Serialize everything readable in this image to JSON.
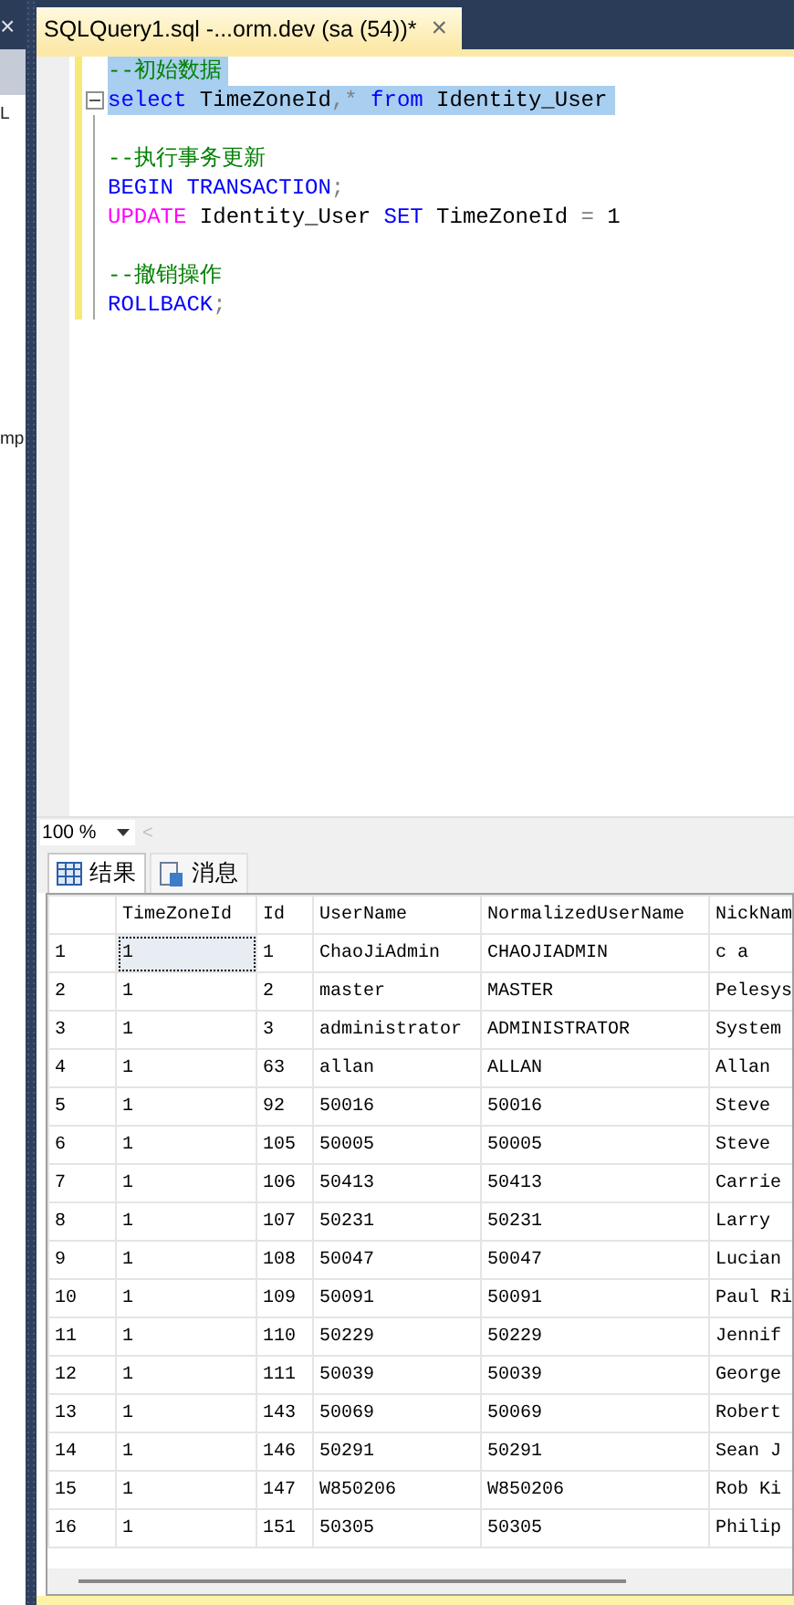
{
  "side_panel": {
    "close": "×",
    "texts": [
      "L",
      "mp"
    ]
  },
  "document_tab": {
    "title": "SQLQuery1.sql -...orm.dev (sa (54))*",
    "close": "×",
    "selected": true
  },
  "editor": {
    "lines": [
      {
        "changed": true,
        "selected": true,
        "segments": [
          {
            "kind": "comment",
            "text": "--初始数据"
          }
        ]
      },
      {
        "changed": true,
        "selected": true,
        "fold": true,
        "segments": [
          {
            "kind": "keyword",
            "text": "select"
          },
          {
            "kind": "plain",
            "text": " TimeZoneId"
          },
          {
            "kind": "punct",
            "text": ",*"
          },
          {
            "kind": "keyword",
            "text": " from"
          },
          {
            "kind": "plain",
            "text": " Identity_User"
          }
        ]
      },
      {
        "changed": true
      },
      {
        "changed": true,
        "selected": false,
        "segments": [
          {
            "kind": "comment",
            "text": "--执行事务更新"
          }
        ]
      },
      {
        "changed": true,
        "selected": false,
        "segments": [
          {
            "kind": "keyword",
            "text": "BEGIN TRANSACTION"
          },
          {
            "kind": "punct",
            "text": ";"
          }
        ]
      },
      {
        "changed": true,
        "selected": false,
        "segments": [
          {
            "kind": "function",
            "text": "UPDATE"
          },
          {
            "kind": "plain",
            "text": " Identity_User "
          },
          {
            "kind": "keyword",
            "text": "SET"
          },
          {
            "kind": "plain",
            "text": " TimeZoneId "
          },
          {
            "kind": "punct",
            "text": "="
          },
          {
            "kind": "plain",
            "text": " 1"
          }
        ]
      },
      {
        "changed": true
      },
      {
        "changed": true,
        "selected": false,
        "segments": [
          {
            "kind": "comment",
            "text": "--撤销操作"
          }
        ]
      },
      {
        "changed": true,
        "selected": false,
        "segments": [
          {
            "kind": "keyword",
            "text": "ROLLBACK"
          },
          {
            "kind": "punct",
            "text": ";"
          }
        ]
      }
    ]
  },
  "zoom": {
    "value": "100 %",
    "scroll_left": "<"
  },
  "result_tabs": [
    {
      "label": "结果",
      "kind": "grid",
      "selected": true
    },
    {
      "label": "消息",
      "kind": "messages",
      "selected": false
    }
  ],
  "table": {
    "columns": [
      "",
      "TimeZoneId",
      "Id",
      "UserName",
      "NormalizedUserName",
      "NickNam"
    ],
    "rows": [
      {
        "focused": true,
        "cells": [
          "1",
          "1",
          "1",
          "ChaoJiAdmin",
          "CHAOJIADMIN",
          "c a"
        ]
      },
      {
        "focused": false,
        "cells": [
          "2",
          "1",
          "2",
          "master",
          "MASTER",
          "Pelesys"
        ]
      },
      {
        "focused": false,
        "cells": [
          "3",
          "1",
          "3",
          "administrator",
          "ADMINISTRATOR",
          "System"
        ]
      },
      {
        "focused": false,
        "cells": [
          "4",
          "1",
          "63",
          "allan",
          "ALLAN",
          "Allan"
        ]
      },
      {
        "focused": false,
        "cells": [
          "5",
          "1",
          "92",
          "50016",
          "50016",
          "Steve"
        ]
      },
      {
        "focused": false,
        "cells": [
          "6",
          "1",
          "105",
          "50005",
          "50005",
          "Steve"
        ]
      },
      {
        "focused": false,
        "cells": [
          "7",
          "1",
          "106",
          "50413",
          "50413",
          "Carrie"
        ]
      },
      {
        "focused": false,
        "cells": [
          "8",
          "1",
          "107",
          "50231",
          "50231",
          "Larry"
        ]
      },
      {
        "focused": false,
        "cells": [
          "9",
          "1",
          "108",
          "50047",
          "50047",
          "Lucian"
        ]
      },
      {
        "focused": false,
        "cells": [
          "10",
          "1",
          "109",
          "50091",
          "50091",
          "Paul Ri"
        ]
      },
      {
        "focused": false,
        "cells": [
          "11",
          "1",
          "110",
          "50229",
          "50229",
          "Jennif"
        ]
      },
      {
        "focused": false,
        "cells": [
          "12",
          "1",
          "111",
          "50039",
          "50039",
          "George"
        ]
      },
      {
        "focused": false,
        "cells": [
          "13",
          "1",
          "143",
          "50069",
          "50069",
          "Robert"
        ]
      },
      {
        "focused": false,
        "cells": [
          "14",
          "1",
          "146",
          "50291",
          "50291",
          "Sean J"
        ]
      },
      {
        "focused": false,
        "cells": [
          "15",
          "1",
          "147",
          "W850206",
          "W850206",
          "Rob Ki"
        ]
      },
      {
        "focused": false,
        "cells": [
          "16",
          "1",
          "151",
          "50305",
          "50305",
          "Philip"
        ]
      }
    ]
  }
}
